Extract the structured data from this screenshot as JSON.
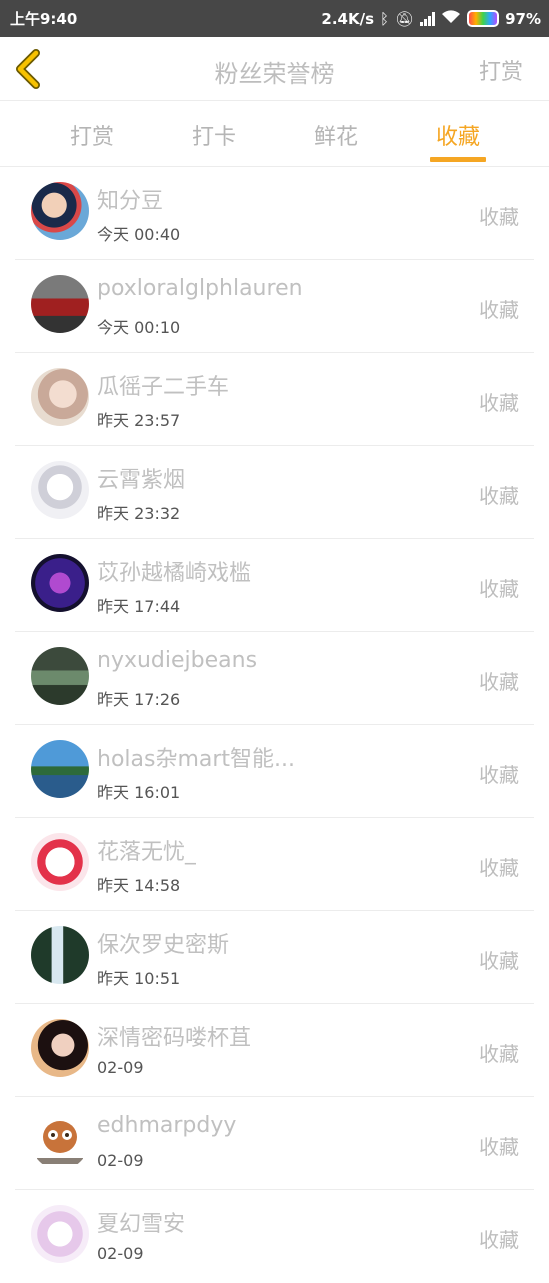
{
  "status_bar": {
    "time": "上午9:40",
    "speed": "2.4K/s",
    "battery": "97%"
  },
  "header": {
    "title": "粉丝荣誉榜",
    "action": "打赏"
  },
  "tabs": [
    {
      "label": "打赏",
      "active": false
    },
    {
      "label": "打卡",
      "active": false
    },
    {
      "label": "鲜花",
      "active": false
    },
    {
      "label": "收藏",
      "active": true
    }
  ],
  "colors": {
    "accent": "#f5a623"
  },
  "list": [
    {
      "name": "知分豆",
      "time": "今天 00:40",
      "action": "收藏"
    },
    {
      "name": "poxloralglphlauren",
      "time": "今天 00:10",
      "action": "收藏"
    },
    {
      "name": "瓜徭子二手车",
      "time": "昨天 23:57",
      "action": "收藏"
    },
    {
      "name": "云霄紫烟",
      "time": "昨天 23:32",
      "action": "收藏"
    },
    {
      "name": "苡孙越橘崎戏槛",
      "time": "昨天 17:44",
      "action": "收藏"
    },
    {
      "name": "nyxudiejbeans",
      "time": "昨天 17:26",
      "action": "收藏"
    },
    {
      "name": "holas杂mart智能...",
      "time": "昨天 16:01",
      "action": "收藏"
    },
    {
      "name": "花落无忧_",
      "time": "昨天 14:58",
      "action": "收藏"
    },
    {
      "name": "保次罗史密斯",
      "time": "昨天 10:51",
      "action": "收藏"
    },
    {
      "name": "深情密码喽杯苴",
      "time": "02-09",
      "action": "收藏"
    },
    {
      "name": "edhmarpdyy",
      "time": "02-09",
      "action": "收藏"
    },
    {
      "name": "夏幻雪安",
      "time": "02-09",
      "action": "收藏"
    }
  ]
}
